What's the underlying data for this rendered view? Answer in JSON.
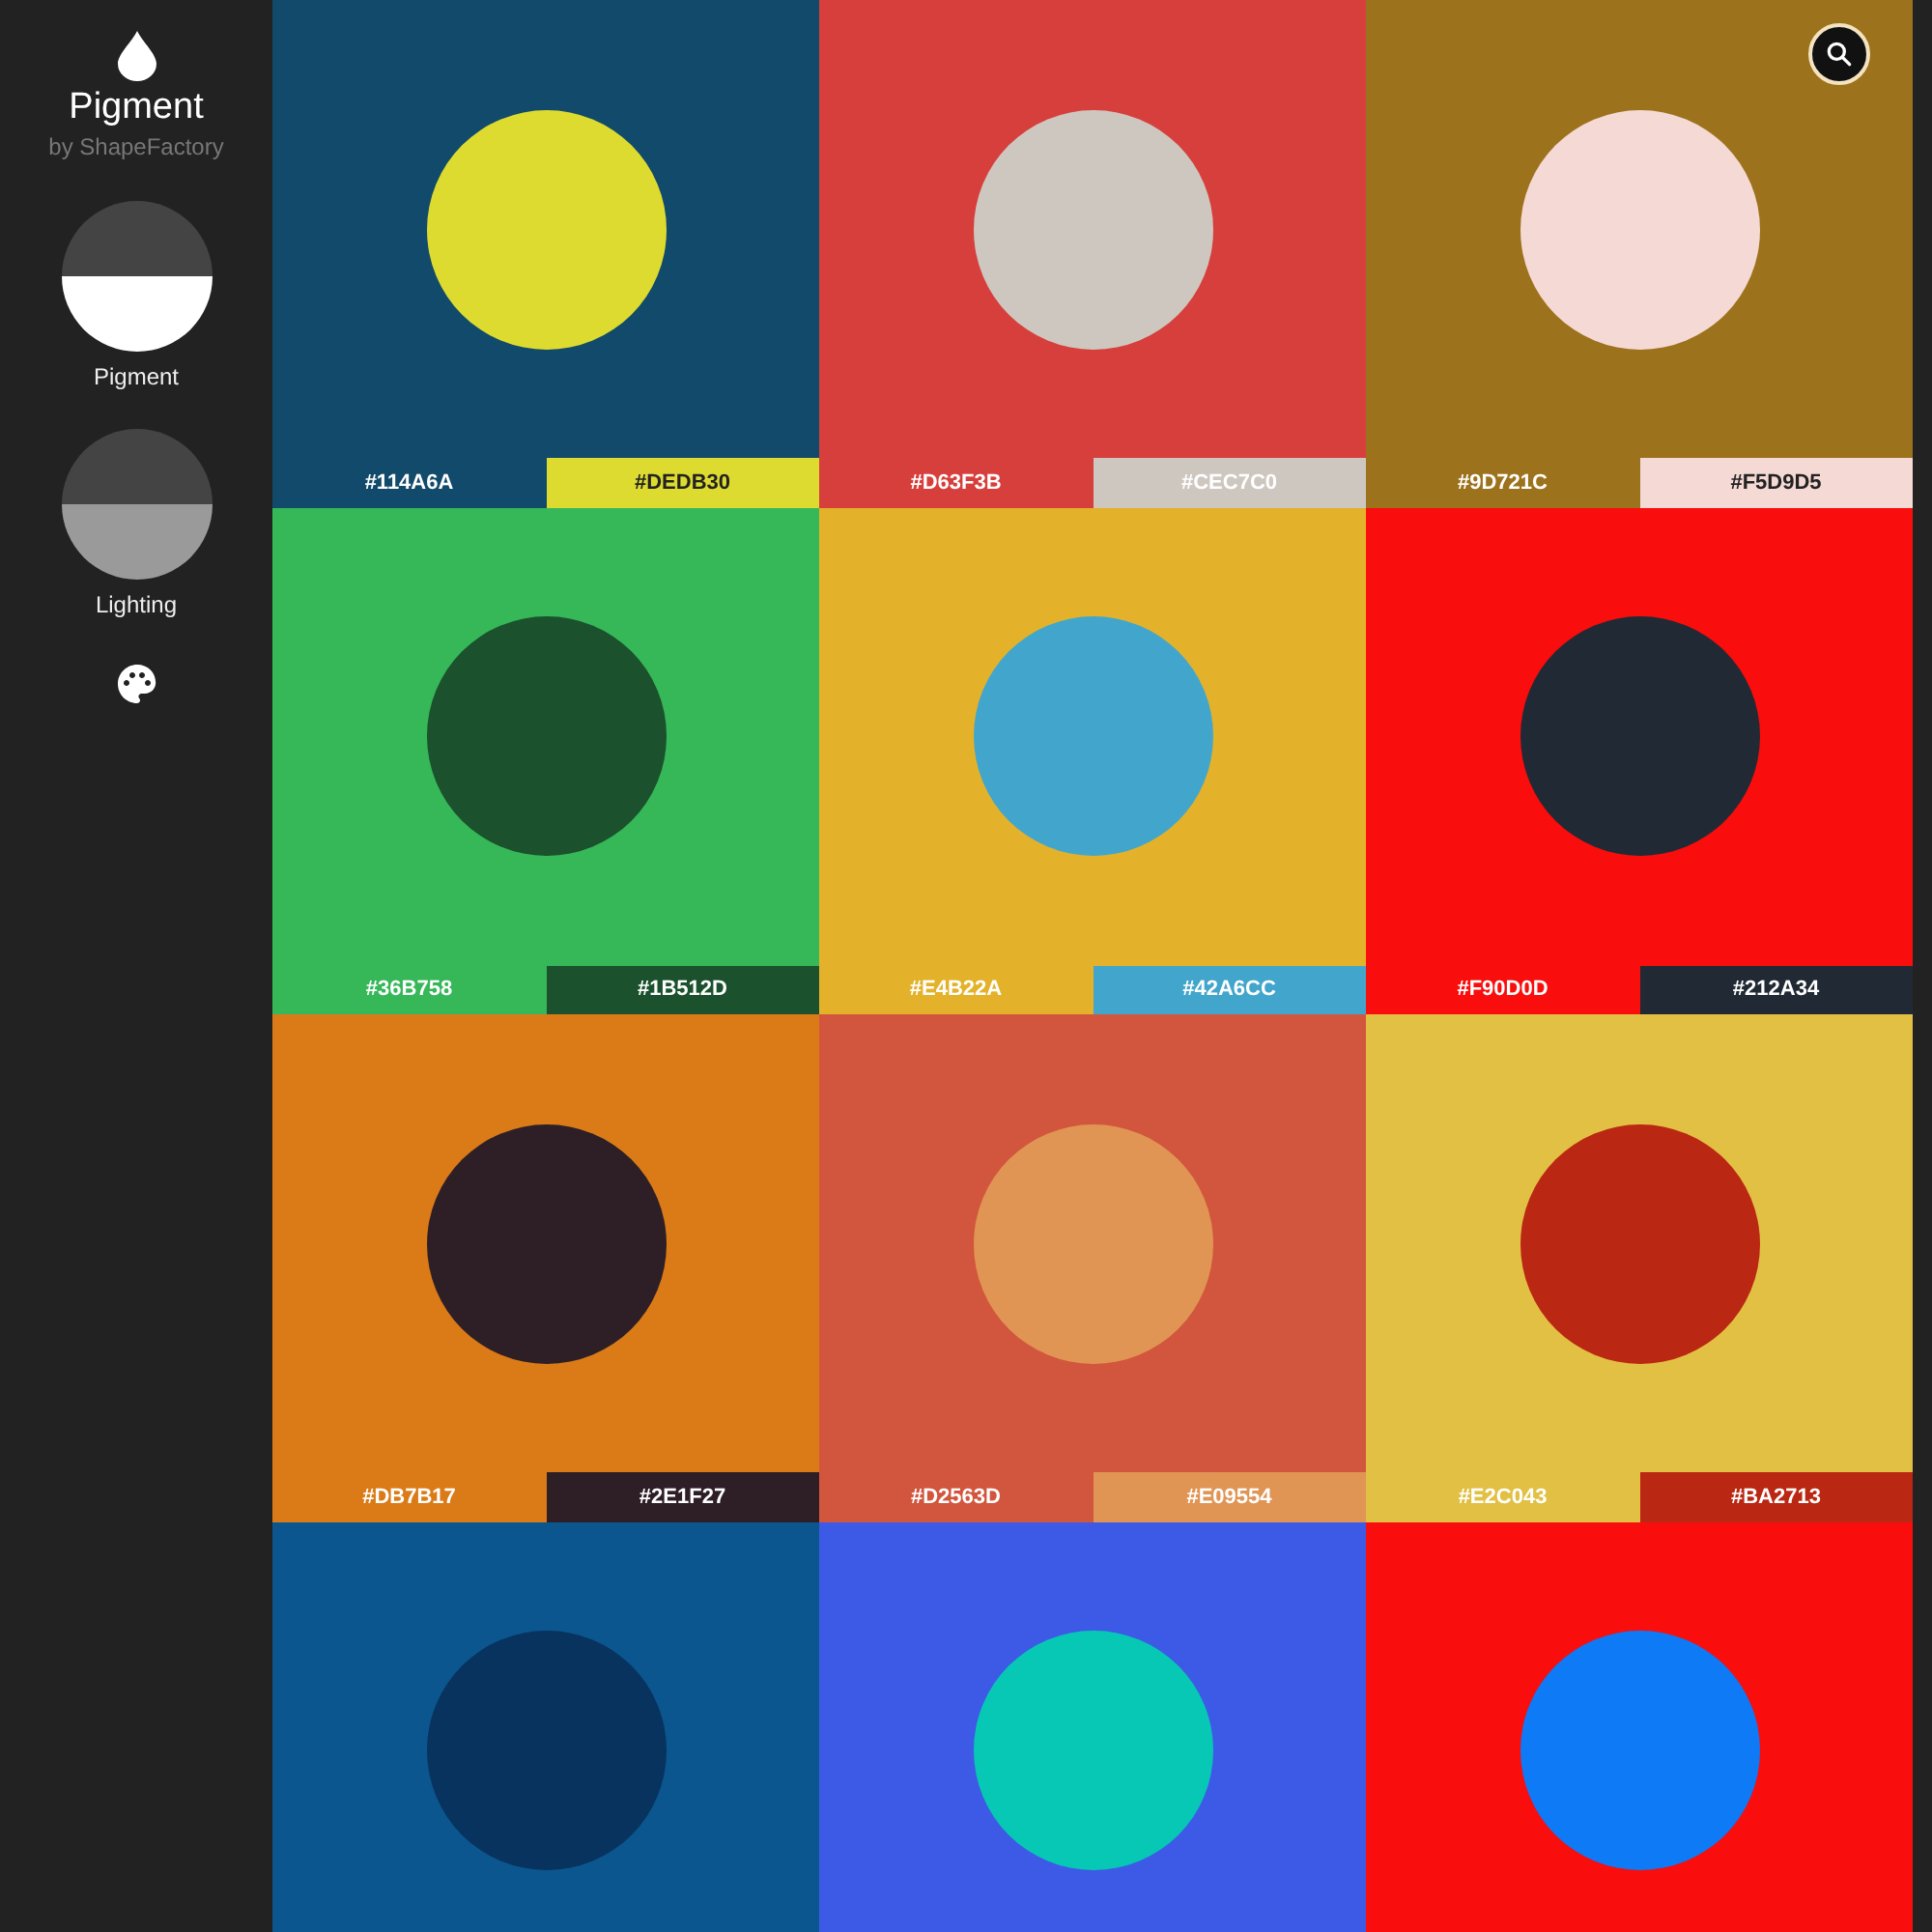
{
  "app": {
    "title": "Pigment",
    "subtitle": "by ShapeFactory"
  },
  "modes": [
    {
      "label": "Pigment",
      "selected": true
    },
    {
      "label": "Lighting",
      "selected": false
    }
  ],
  "tiles": [
    {
      "background": {
        "color": "#114a6a",
        "hex": "#114A6A",
        "dark_text": false
      },
      "circle": {
        "color": "#dedb30",
        "hex": "#DEDB30",
        "dark_text": true
      }
    },
    {
      "background": {
        "color": "#d63f3b",
        "hex": "#D63F3B",
        "dark_text": false
      },
      "circle": {
        "color": "#cec7c0",
        "hex": "#CEC7C0",
        "dark_text": false
      }
    },
    {
      "background": {
        "color": "#9d721c",
        "hex": "#9D721C",
        "dark_text": false
      },
      "circle": {
        "color": "#f5d9d5",
        "hex": "#F5D9D5",
        "dark_text": true
      }
    },
    {
      "background": {
        "color": "#36b758",
        "hex": "#36B758",
        "dark_text": false
      },
      "circle": {
        "color": "#1b512d",
        "hex": "#1B512D",
        "dark_text": false
      }
    },
    {
      "background": {
        "color": "#e4b22a",
        "hex": "#E4B22A",
        "dark_text": false
      },
      "circle": {
        "color": "#42a6cc",
        "hex": "#42A6CC",
        "dark_text": false
      }
    },
    {
      "background": {
        "color": "#f90d0d",
        "hex": "#F90D0D",
        "dark_text": false
      },
      "circle": {
        "color": "#212a34",
        "hex": "#212A34",
        "dark_text": false
      }
    },
    {
      "background": {
        "color": "#db7b17",
        "hex": "#DB7B17",
        "dark_text": false
      },
      "circle": {
        "color": "#2e1f27",
        "hex": "#2E1F27",
        "dark_text": false
      }
    },
    {
      "background": {
        "color": "#d2563d",
        "hex": "#D2563D",
        "dark_text": false
      },
      "circle": {
        "color": "#e09554",
        "hex": "#E09554",
        "dark_text": false
      }
    },
    {
      "background": {
        "color": "#e2c043",
        "hex": "#E2C043",
        "dark_text": false
      },
      "circle": {
        "color": "#ba2713",
        "hex": "#BA2713",
        "dark_text": false
      }
    },
    {
      "background": {
        "color": "#0b568f"
      },
      "circle": {
        "color": "#08335e"
      }
    },
    {
      "background": {
        "color": "#3d5ae6"
      },
      "circle": {
        "color": "#07c8b5"
      }
    },
    {
      "background": {
        "color": "#f90d0d"
      },
      "circle": {
        "color": "#0e7af5"
      }
    }
  ]
}
